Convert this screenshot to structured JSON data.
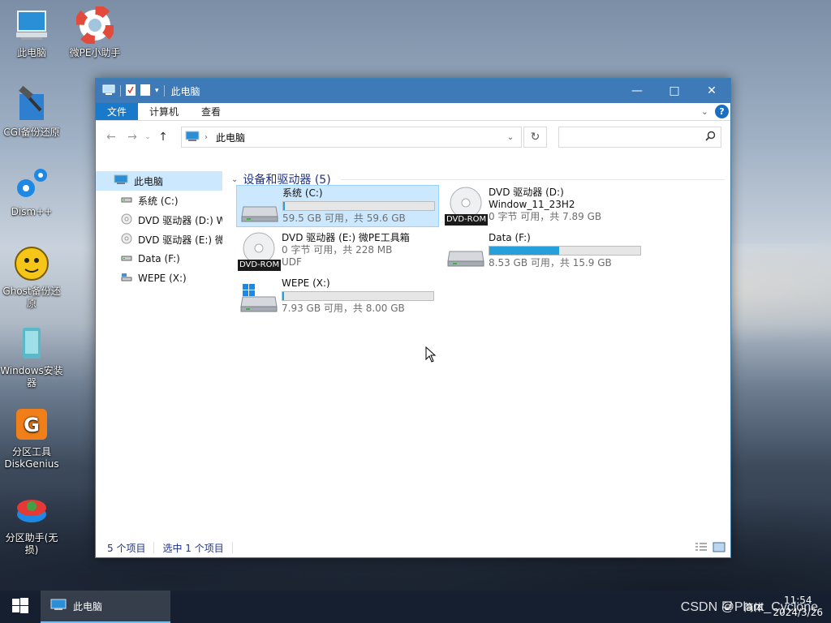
{
  "desktop": {
    "icons": [
      {
        "label": "此电脑",
        "icon": "computer-icon"
      },
      {
        "label": "微PE小助手",
        "icon": "lifebuoy-icon"
      },
      {
        "label": "CGI备份还原",
        "icon": "cgi-hammer-icon"
      },
      {
        "label": "Dism++",
        "icon": "gears-icon"
      },
      {
        "label": "Ghost备份还原",
        "icon": "ghost-icon"
      },
      {
        "label": "Windows安装器",
        "icon": "windows-installer-icon"
      },
      {
        "label": "分区工具DiskGenius",
        "icon": "diskgenius-icon"
      },
      {
        "label": "分区助手(无损)",
        "icon": "partition-assistant-icon"
      }
    ]
  },
  "window": {
    "title": "此电脑",
    "ribbon_tabs": [
      "文件",
      "计算机",
      "查看"
    ],
    "address": "此电脑",
    "search_placeholder": "",
    "nav_pane": [
      {
        "label": "此电脑",
        "icon": "computer-icon",
        "selected": true
      },
      {
        "label": "系统 (C:)",
        "icon": "drive-icon"
      },
      {
        "label": "DVD 驱动器 (D:) W",
        "icon": "dvd-icon"
      },
      {
        "label": "DVD 驱动器 (E:) 微",
        "icon": "dvd-icon"
      },
      {
        "label": "Data (F:)",
        "icon": "drive-icon"
      },
      {
        "label": "WEPE (X:)",
        "icon": "network-drive-icon"
      }
    ],
    "group_header": "设备和驱动器 (5)",
    "drives": [
      {
        "name": "系统 (C:)",
        "detail": "59.5 GB 可用，共 59.6 GB",
        "fill": 0.002,
        "icon": "hdd-icon",
        "selected": true
      },
      {
        "name": "DVD 驱动器 (D:)",
        "label2": "Window_11_23H2",
        "detail": "0 字节 可用，共 7.89 GB",
        "icon": "dvd-rom-icon",
        "badge": "DVD-ROM"
      },
      {
        "name": "DVD 驱动器 (E:) 微PE工具箱",
        "detail": "0 字节 可用，共 228 MB",
        "label2": "UDF",
        "icon": "dvd-rom-icon",
        "badge": "DVD-ROM"
      },
      {
        "name": "Data (F:)",
        "detail": "8.53 GB 可用，共 15.9 GB",
        "fill": 0.463,
        "icon": "hdd-icon"
      },
      {
        "name": "WEPE (X:)",
        "detail": "7.93 GB 可用，共 8.00 GB",
        "fill": 0.009,
        "icon": "windows-drive-icon"
      }
    ],
    "status": {
      "items": "5 个项目",
      "selected": "选中 1 个项目"
    }
  },
  "taskbar": {
    "task_label": "此电脑",
    "time": "11:54",
    "date": "2024/3/26",
    "tray_text": "简体"
  },
  "watermark": "CSDN @Plant_Cyclone"
}
